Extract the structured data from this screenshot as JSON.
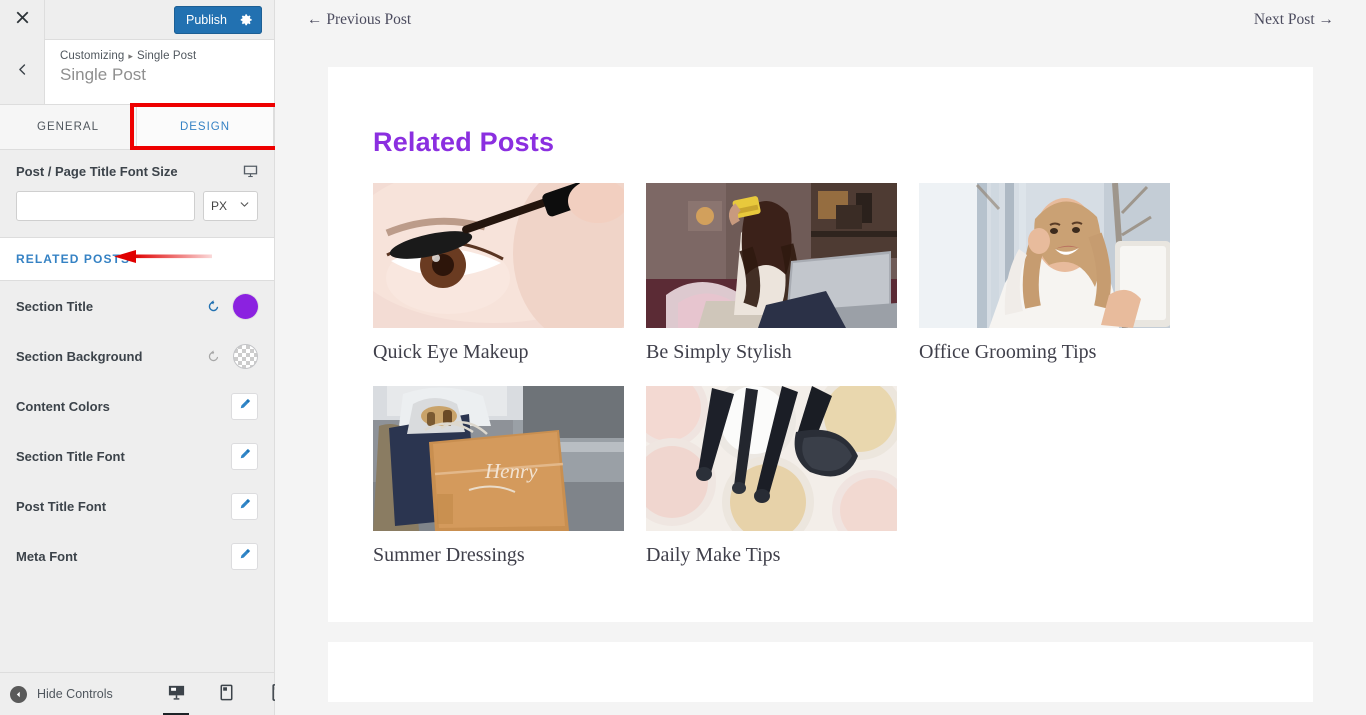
{
  "sidebar": {
    "topbar": {
      "close_label": "Close",
      "close_icon": "close-icon",
      "publish_label": "Publish",
      "gear_icon": "gear-icon"
    },
    "header": {
      "back_icon": "chevron-left-icon",
      "breadcrumb_root": "Customizing",
      "breadcrumb_separator": "▸",
      "breadcrumb_current": "Single Post",
      "panel_title": "Single Post"
    },
    "tabs": [
      {
        "label": "GENERAL",
        "active": false
      },
      {
        "label": "DESIGN",
        "active": true
      }
    ],
    "font_size_control": {
      "label": "Post / Page Title Font Size",
      "responsive_icon": "desktop-icon",
      "value": "",
      "unit": "PX",
      "unit_caret_icon": "chevron-down-icon"
    },
    "section_header": {
      "label": "RELATED POSTS",
      "annotation_icon": "red-arrow-left-icon"
    },
    "rows": [
      {
        "label": "Section Title",
        "control": "color",
        "reset_icon": "reset-icon",
        "reset_active": true,
        "color": "#8b22e0"
      },
      {
        "label": "Section Background",
        "control": "color",
        "reset_icon": "reset-icon",
        "reset_active": false,
        "color": "transparent"
      },
      {
        "label": "Content Colors",
        "control": "edit",
        "edit_icon": "pencil-icon"
      },
      {
        "label": "Section Title Font",
        "control": "edit",
        "edit_icon": "pencil-icon"
      },
      {
        "label": "Post Title Font",
        "control": "edit",
        "edit_icon": "pencil-icon"
      },
      {
        "label": "Meta Font",
        "control": "edit",
        "edit_icon": "pencil-icon"
      }
    ],
    "footer": {
      "hide_controls_label": "Hide Controls",
      "collapse_icon": "collapse-left-icon",
      "devices": [
        {
          "name": "desktop",
          "icon": "desktop-icon",
          "active": true
        },
        {
          "name": "tablet",
          "icon": "tablet-icon",
          "active": false
        },
        {
          "name": "mobile",
          "icon": "mobile-icon",
          "active": false
        }
      ]
    }
  },
  "preview": {
    "post_nav": {
      "previous_label": "← Previous Post",
      "next_label": "Next Post →"
    },
    "related_posts": {
      "heading": "Related Posts",
      "heading_color": "#8b2fe0",
      "items": [
        {
          "title": "Quick Eye Makeup",
          "image": "closeup-eye-mascara"
        },
        {
          "title": "Be Simply Stylish",
          "image": "woman-credit-card-laptop"
        },
        {
          "title": "Office Grooming Tips",
          "image": "woman-tablet-outdoors"
        },
        {
          "title": "Summer Dressings",
          "image": "shopping-bags-henry"
        },
        {
          "title": "Daily Make Tips",
          "image": "makeup-powders-brushes"
        }
      ]
    }
  }
}
